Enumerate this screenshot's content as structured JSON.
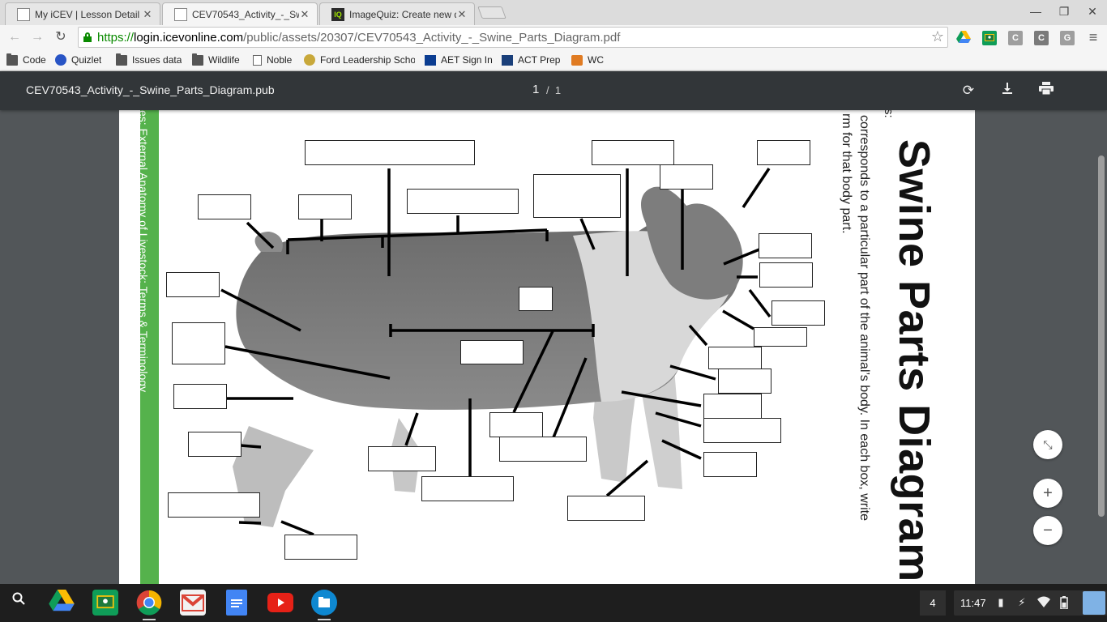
{
  "browser": {
    "tabs": [
      {
        "title": "My iCEV | Lesson Detail",
        "favicon": "page-icon",
        "active": false
      },
      {
        "title": "CEV70543_Activity_-_Swi",
        "favicon": "page-icon",
        "active": true
      },
      {
        "title": "ImageQuiz: Create new q",
        "favicon": "IQ",
        "active": false
      }
    ],
    "url": {
      "scheme": "https://",
      "host": "login.icevonline.com",
      "path": "/public/assets/20307/CEV70543_Activity_-_Swine_Parts_Diagram.pdf"
    },
    "extensions": [
      "drive-icon",
      "classroom-icon",
      "C",
      "C",
      "G"
    ],
    "bookmarks": [
      {
        "label": "Code",
        "icon": "folder-icon"
      },
      {
        "label": "Quizlet",
        "icon": "quizlet-icon"
      },
      {
        "label": "Issues data",
        "icon": "folder-icon"
      },
      {
        "label": "Wildlife",
        "icon": "folder-icon"
      },
      {
        "label": "Noble",
        "icon": "page-icon"
      },
      {
        "label": "Ford Leadership Scho",
        "icon": "ffa-icon"
      },
      {
        "label": "AET Sign In",
        "icon": "aet-icon"
      },
      {
        "label": "ACT Prep",
        "icon": "act-icon"
      },
      {
        "label": "WC",
        "icon": "wc-icon"
      }
    ]
  },
  "pdf": {
    "filename": "CEV70543_Activity_-_Swine_Parts_Diagram.pub",
    "page_current": "1",
    "page_total": "1",
    "page_separator": "/",
    "heading": "Swine Parts Diagram",
    "side_label": "es: External Anatomy of Livestock:  Terms & Terminology",
    "instruction_line1": "corresponds to a particular part of the animal’s body. In each box, write",
    "instruction_line2": "rm for that body part.",
    "instruction_fragment": "s:",
    "zoom_buttons": {
      "fit": "⤡",
      "zoom_in": "+",
      "zoom_out": "−"
    }
  },
  "shelf": {
    "apps": [
      "search-icon",
      "drive-icon",
      "classroom-icon",
      "chrome-icon",
      "gmail-icon",
      "docs-icon",
      "youtube-icon",
      "files-icon"
    ],
    "notification_count": "4",
    "time": "11:47"
  }
}
